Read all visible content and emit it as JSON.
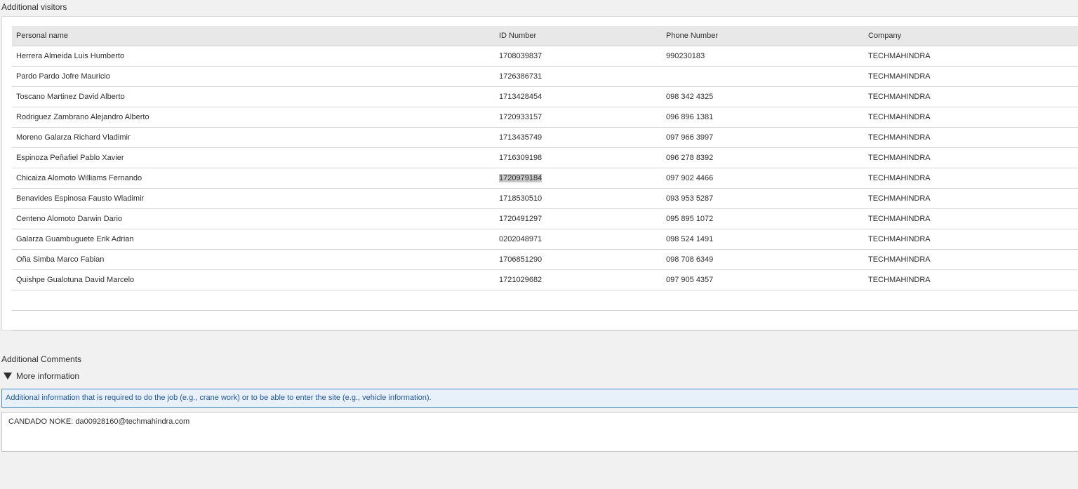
{
  "additional_visitors": {
    "label": "Additional visitors",
    "columns": [
      "Personal name",
      "ID Number",
      "Phone Number",
      "Company"
    ],
    "rows": [
      [
        "Herrera Almeida Luis Humberto",
        "1708039837",
        "990230183",
        "TECHMAHINDRA"
      ],
      [
        "Pardo Pardo Jofre Mauricio",
        "1726386731",
        "",
        "TECHMAHINDRA"
      ],
      [
        "Toscano Martinez David Alberto",
        "1713428454",
        "098 342 4325",
        "TECHMAHINDRA"
      ],
      [
        "Rodriguez Zambrano Alejandro Alberto",
        "1720933157",
        "096 896 1381",
        "TECHMAHINDRA"
      ],
      [
        "Moreno Galarza Richard Vladimir",
        "1713435749",
        "097 966 3997",
        "TECHMAHINDRA"
      ],
      [
        "Espinoza Peñafiel Pablo Xavier",
        "1716309198",
        "096 278 8392",
        "TECHMAHINDRA"
      ],
      [
        "Chicaiza Alomoto Williams Fernando",
        "1720979184",
        "097 902 4466",
        "TECHMAHINDRA"
      ],
      [
        "Benavides Espinosa Fausto Wladimir",
        "1718530510",
        "093 953 5287",
        "TECHMAHINDRA"
      ],
      [
        "Centeno Alomoto Darwin Dario",
        "1720491297",
        "095 895 1072",
        "TECHMAHINDRA"
      ],
      [
        "Galarza Guambuguete Erik Adrian",
        "0202048971",
        "098 524 1491",
        "TECHMAHINDRA"
      ],
      [
        "Oña Simba Marco Fabian",
        "1706851290",
        "098 708 6349",
        "TECHMAHINDRA"
      ],
      [
        "Quishpe Gualotuna David Marcelo",
        "1721029682",
        "097 905 4357",
        "TECHMAHINDRA"
      ]
    ]
  },
  "additional_comments": {
    "label": "Additional Comments",
    "more_information": "More information",
    "info_text": "Additional information that is required to do the job (e.g., crane work) or to be able to enter the site (e.g., vehicle information).",
    "comment_value": "CANDADO NOKE: da00928160@techmahindra.com"
  },
  "colors": {
    "info_background": "#e8f1f9",
    "info_border": "#4e8fc4",
    "info_text": "#24579a",
    "selection_highlight": "#c8c8c8"
  }
}
